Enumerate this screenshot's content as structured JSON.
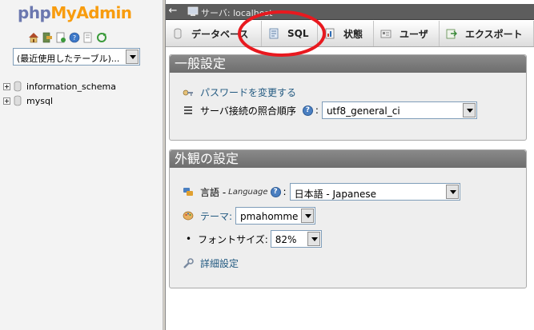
{
  "nav": {
    "logo_php": "php",
    "logo_myadmin": "MyAdmin",
    "icons": [
      "home-icon",
      "exit-icon",
      "query-window-icon",
      "docs-icon",
      "sql-docs-icon",
      "reload-icon"
    ],
    "recent_tables_select": "(最近使用したテーブル)...",
    "databases": [
      {
        "name": "information_schema"
      },
      {
        "name": "mysql"
      }
    ]
  },
  "serverbar": {
    "back": "←",
    "title": "サーバ: localhost"
  },
  "tabs": [
    {
      "label": "データベース",
      "icon": "database-icon"
    },
    {
      "label": "SQL",
      "icon": "sql-icon"
    },
    {
      "label": "状態",
      "icon": "status-icon"
    },
    {
      "label": "ユーザ",
      "icon": "users-icon"
    },
    {
      "label": "エクスポート",
      "icon": "export-icon"
    }
  ],
  "general_settings": {
    "title": "一般設定",
    "change_password": "パスワードを変更する",
    "collation_label": "サーバ接続の照合順序",
    "collation_help": "?",
    "collation_colon": ":",
    "collation_value": "utf8_general_ci"
  },
  "appearance_settings": {
    "title": "外観の設定",
    "language_label": "言語 -",
    "language_sub": "Language",
    "language_help": "?",
    "language_colon": ":",
    "language_value": "日本語 - Japanese",
    "theme_label": "テーマ:",
    "theme_value": "pmahomme",
    "font_size_bullet": "•",
    "font_size_label": "フォントサイズ:",
    "font_size_value": "82%",
    "more_settings": "詳細設定"
  },
  "colors": {
    "annotation": "#e8191f",
    "link": "#235a81",
    "panel_header": "#7a7a7a"
  }
}
